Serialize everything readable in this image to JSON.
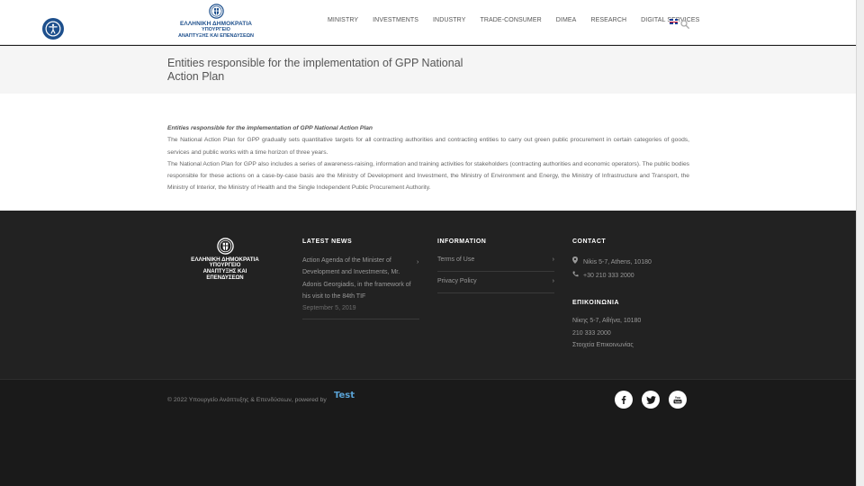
{
  "header": {
    "logo": {
      "line1": "ΕΛΛΗΝΙΚΗ ΔΗΜΟΚΡΑΤΙΑ",
      "line2": "ΥΠΟΥΡΓΕΙΟ",
      "line3": "ΑΝΑΠΤΥΞΗΣ ΚΑΙ ΕΠΕΝΔΥΣΕΩΝ"
    },
    "nav": [
      {
        "label": "MINISTRY"
      },
      {
        "label": "INVESTMENTS"
      },
      {
        "label": "INDUSTRY"
      },
      {
        "label": "TRADE-CONSUMER"
      },
      {
        "label": "DIMEA"
      },
      {
        "label": "RESEARCH"
      },
      {
        "label": "DIGITAL SERVICES"
      }
    ],
    "icons": {
      "accessibility": "accessibility-icon",
      "flag": "uk-flag-icon",
      "search": "search-icon"
    }
  },
  "page_title": "Entities responsible for the implementation of GPP National Action Plan",
  "article": {
    "heading": "Entities responsible for the implementation of GPP National Action Plan",
    "p1": "The National Action Plan for GPP gradually sets quantitative targets for all contracting authorities and contracting entities to carry out green public procurement in certain categories of goods, services and public works with a time horizon of three years.",
    "p2": "The National Action Plan for GPP also includes a series of awareness-raising, information and training activities for stakeholders (contracting authorities and economic operators). The public bodies responsible for these actions on a case-by-case basis are the Ministry of Development and Investment, the Ministry of Environment and Energy, the Ministry of Infrastructure and Transport, the Ministry of Interior, the Ministry of Health and the Single Independent Public Procurement Authority."
  },
  "footer": {
    "logo": {
      "line1": "ΕΛΛΗΝΙΚΗ ΔΗΜΟΚΡΑΤΙΑ",
      "line2": "ΥΠΟΥΡΓΕΙΟ",
      "line3": "ΑΝΑΠΤΥΞΗΣ ΚΑΙ ΕΠΕΝΔΥΣΕΩΝ"
    },
    "latest_news": {
      "title": "LATEST NEWS",
      "item": "Action Agenda of the Minister of Development and Investments, Mr. Adonis Georgiadis, in the framework of his visit to the 84th TIF",
      "date": "September 5, 2019"
    },
    "information": {
      "title": "INFORMATION",
      "links": [
        {
          "label": "Terms of Use"
        },
        {
          "label": "Privacy Policy"
        }
      ]
    },
    "contact": {
      "title": "CONTACT",
      "address": "Nikis 5-7, Athens, 10180",
      "phone": "+30 210 333 2000",
      "title_gr": "ΕΠΙΚΟΙΝΩΝΙΑ",
      "address_gr": "Νίκης 5-7, Αθήνα, 10180",
      "phone_gr": "210 333 2000",
      "link_gr": "Στοιχεία Επικοινωνίας"
    }
  },
  "bottom": {
    "copyright": "© 2022 Υπουργείο Ανάπτυξης & Επενδύσεων, powered by",
    "brand": "Test",
    "social": [
      {
        "name": "facebook-icon",
        "glyph": "f"
      },
      {
        "name": "twitter-icon",
        "glyph": "t"
      },
      {
        "name": "youtube-icon",
        "glyph": "You"
      }
    ]
  },
  "colors": {
    "brand_blue": "#1d4f8c",
    "footer_bg": "#222222",
    "link_blue": "#5aa3d6"
  }
}
